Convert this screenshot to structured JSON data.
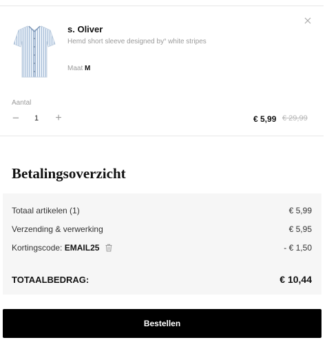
{
  "product": {
    "brand": "s. Oliver",
    "description": "Hemd short sleeve designed by“ white stripes",
    "size_label": "Maat",
    "size_value": "M",
    "image_icon": "shirt-icon",
    "close_icon": "close-icon"
  },
  "quantity": {
    "label": "Aantal",
    "minus": "−",
    "value": "1",
    "plus": "+"
  },
  "price": {
    "current": "€ 5,99",
    "original": "€ 29,99"
  },
  "summary": {
    "title": "Betalingsoverzicht",
    "rows": [
      {
        "label": "Totaal artikelen (1)",
        "value": "€ 5,99"
      },
      {
        "label": "Verzending & verwerking",
        "value": "€ 5,95"
      }
    ],
    "discount": {
      "label": "Kortingscode:",
      "code": "EMAIL25",
      "value": "- € 1,50",
      "icon": "trash-icon"
    },
    "total_label": "TOTAALBEDRAG:",
    "total_value": "€ 10,44"
  },
  "actions": {
    "order_label": "Bestellen"
  },
  "colors": {
    "summary_bg": "#f6f6f6",
    "button_bg": "#000000",
    "muted_text": "#9a9a9a",
    "strikethrough": "#b5b5b5"
  }
}
